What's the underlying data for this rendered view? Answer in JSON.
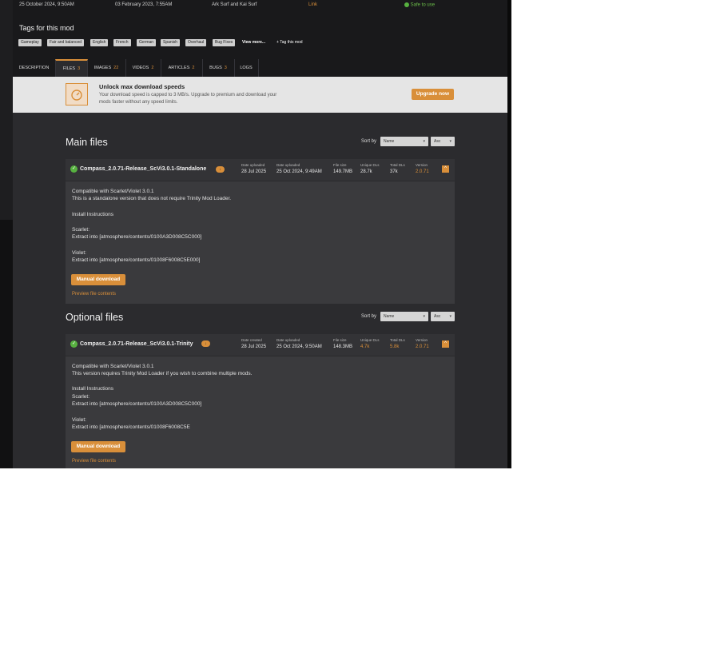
{
  "meta": {
    "created": "25 October 2024, 9:50AM",
    "uploaded": "03 February 2023, 7:55AM",
    "authors": "Ark Surf and Kai Surf",
    "link": "Link",
    "safe": "Safe to use"
  },
  "tags": {
    "title": "Tags for this mod",
    "items": [
      "Gameplay",
      "Fair and balanced",
      "English",
      "French",
      "German",
      "Spanish",
      "Overhaul",
      "Bug Fixes"
    ],
    "view_more": "View more...",
    "tag_this": "+ Tag this mod"
  },
  "tabs": [
    {
      "label": "DESCRIPTION",
      "count": ""
    },
    {
      "label": "FILES",
      "count": "3"
    },
    {
      "label": "IMAGES",
      "count": "22"
    },
    {
      "label": "VIDEOS",
      "count": "2"
    },
    {
      "label": "ARTICLES",
      "count": "2"
    },
    {
      "label": "BUGS",
      "count": "3"
    },
    {
      "label": "LOGS",
      "count": ""
    }
  ],
  "banner": {
    "title": "Unlock max download speeds",
    "desc": "Your download speed is capped to 3 MB/s. Upgrade to premium and download your mods faster without any speed limits.",
    "button": "Upgrade now"
  },
  "sort": {
    "label": "Sort by",
    "field": "Name",
    "order": "Asc"
  },
  "main": {
    "title": "Main files",
    "file": {
      "name": "Compass_2.0.71-Release_ScVi3.0.1-Standalone",
      "stats": [
        {
          "label": "Date uploaded",
          "value": "28 Jul 2025",
          "orange": false
        },
        {
          "label": "Date uploaded",
          "value": "25 Oct 2024, 9:49AM",
          "orange": false
        },
        {
          "label": "File size",
          "value": "149.7MB",
          "orange": false
        },
        {
          "label": "Unique DLs",
          "value": "28.7k",
          "orange": false
        },
        {
          "label": "Total DLs",
          "value": "37k",
          "orange": false
        },
        {
          "label": "Version",
          "value": "2.0.71",
          "orange": true
        }
      ],
      "lines": [
        "Compatible with Scarlet/Violet 3.0.1",
        "This is a standalone version that does not require Trinity Mod Loader.",
        "Install Instructions",
        "Scarlet:",
        "Extract into [atmosphere/contents/0100A3D008C5C000]",
        "Violet:",
        "Extract into [atmosphere/contents/01008F6008C5E000]"
      ],
      "button": "Manual download",
      "preview": "Preview file contents"
    }
  },
  "optional": {
    "title": "Optional files",
    "file": {
      "name": "Compass_2.0.71-Release_ScVi3.0.1-Trinity",
      "stats": [
        {
          "label": "Date created",
          "value": "28 Jul 2025",
          "orange": false
        },
        {
          "label": "Date uploaded",
          "value": "25 Oct 2024, 9:50AM",
          "orange": false
        },
        {
          "label": "File size",
          "value": "148.3MB",
          "orange": false
        },
        {
          "label": "Unique DLs",
          "value": "4.7k",
          "orange": false
        },
        {
          "label": "Total DLs",
          "value": "5.8k",
          "orange": false
        },
        {
          "label": "Version",
          "value": "2.0.71",
          "orange": true
        }
      ],
      "lines": [
        "Compatible with Scarlet/Violet 3.0.1",
        "This version requires Trinity Mod Loader if you wish to combine multiple mods.",
        "Install Instructions",
        "Scarlet:",
        "Extract into [atmosphere/contents/0100A3D008C5C000]",
        "Violet:",
        "Extract into [atmosphere/contents/01008F6008C5E"
      ],
      "button": "Manual download",
      "preview": "Preview file contents"
    }
  }
}
